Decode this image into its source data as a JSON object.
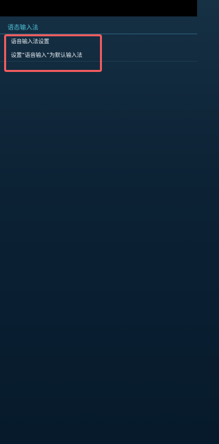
{
  "section": {
    "title": "语态输入法"
  },
  "menu": {
    "items": [
      {
        "label": "语音输入法设置"
      },
      {
        "label": "设置“语音输入”为默认输入法"
      }
    ]
  },
  "colors": {
    "accent": "#4fc3d9",
    "highlight": "#ee5b5e",
    "text": "#e6edf2",
    "background_top": "#163044",
    "background_bottom": "#061a2b"
  }
}
